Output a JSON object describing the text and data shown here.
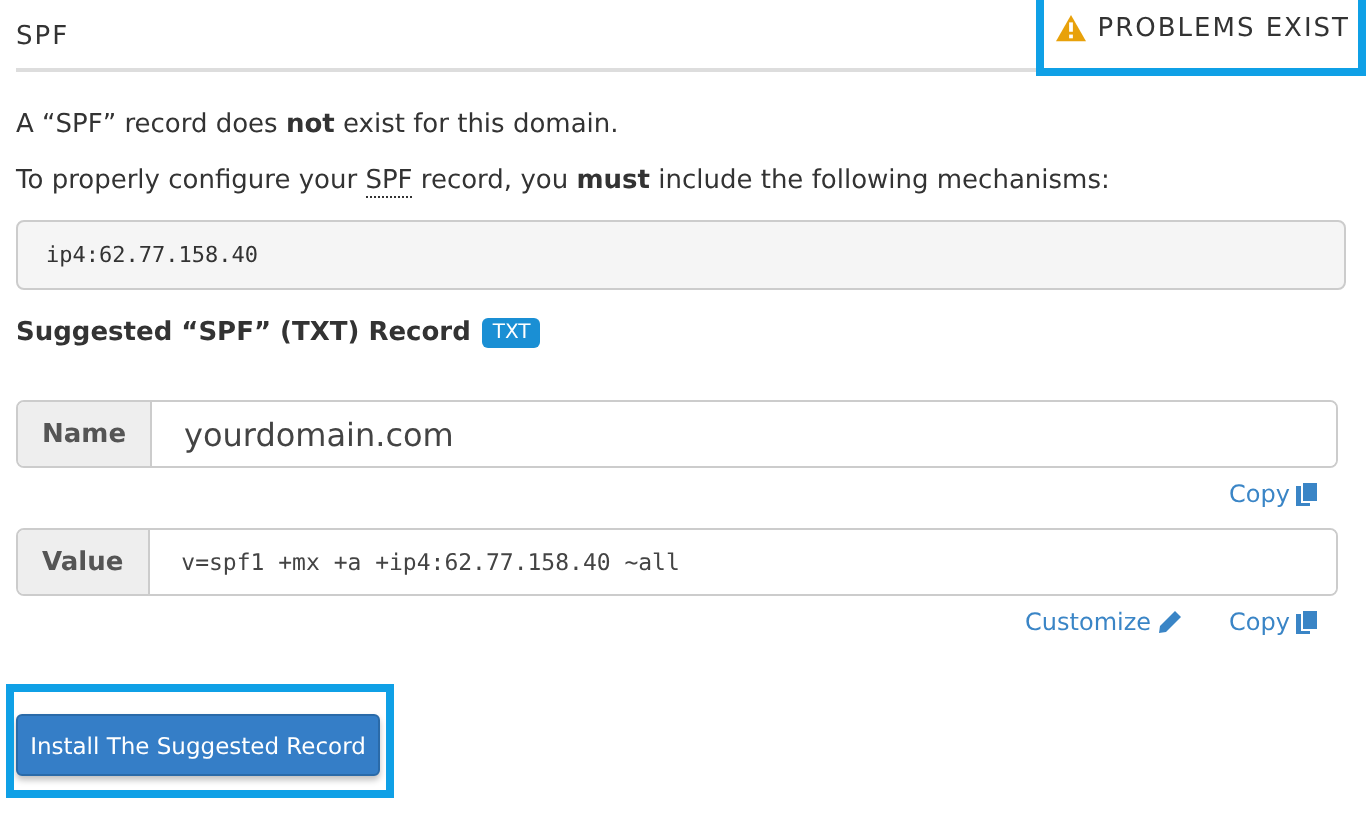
{
  "section": {
    "title": "SPF",
    "status": {
      "label": "PROBLEMS EXIST",
      "kind": "warning",
      "highlighted": true
    }
  },
  "messages": [
    {
      "parts": [
        {
          "kind": "text",
          "text": "A “SPF” record does **not** exist for this domain."
        }
      ]
    },
    {
      "parts": [
        {
          "kind": "text",
          "text": "To properly configure your "
        },
        {
          "kind": "abbr",
          "text": "SPF"
        },
        {
          "kind": "text",
          "text": " record, you **must** include the following mechanisms:"
        }
      ]
    }
  ],
  "mechanisms": "ip4:62.77.158.40",
  "suggested": {
    "label": "Suggested “SPF” (TXT) Record",
    "badge": "TXT"
  },
  "fields": [
    {
      "label": "Name",
      "value": "yourdomain.com",
      "kind": "plain",
      "actions": [
        {
          "label": "Copy",
          "kind": "copy"
        }
      ]
    },
    {
      "label": "Value",
      "value": "v=spf1 +mx +a +ip4:62.77.158.40 ~all",
      "kind": "mono",
      "actions": [
        {
          "label": "Customize",
          "kind": "edit"
        },
        {
          "label": "Copy",
          "kind": "copy"
        }
      ]
    }
  ],
  "install_button": {
    "label": "Install The Suggested Record",
    "highlighted": true
  }
}
